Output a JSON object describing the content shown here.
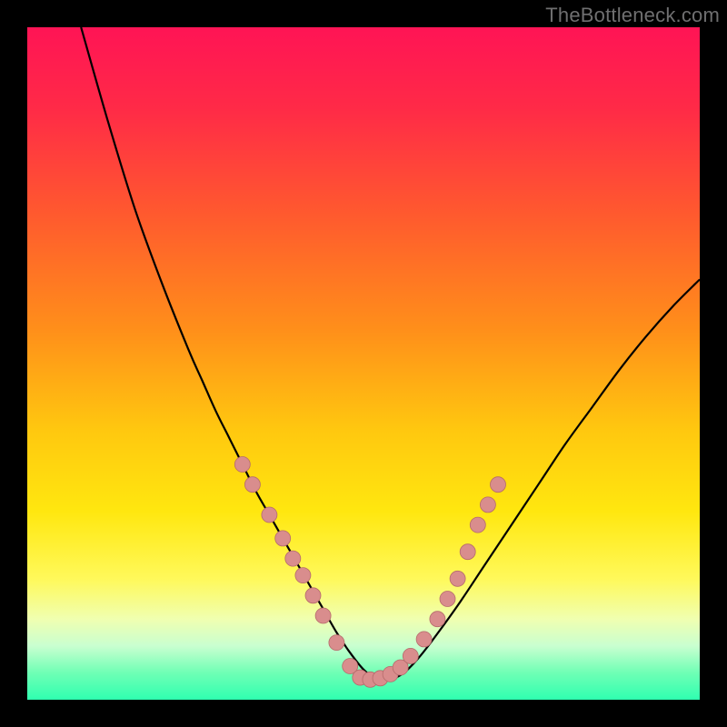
{
  "watermark": "TheBottleneck.com",
  "colors": {
    "background": "#000000",
    "gradient_stops": [
      {
        "offset": 0.0,
        "color": "#ff1455"
      },
      {
        "offset": 0.12,
        "color": "#ff2a47"
      },
      {
        "offset": 0.28,
        "color": "#ff5a2e"
      },
      {
        "offset": 0.45,
        "color": "#ff8f1a"
      },
      {
        "offset": 0.6,
        "color": "#ffc80f"
      },
      {
        "offset": 0.72,
        "color": "#ffe70f"
      },
      {
        "offset": 0.82,
        "color": "#fff95a"
      },
      {
        "offset": 0.88,
        "color": "#f0ffb0"
      },
      {
        "offset": 0.92,
        "color": "#c9ffd0"
      },
      {
        "offset": 0.96,
        "color": "#6fffb5"
      },
      {
        "offset": 1.0,
        "color": "#2fffb0"
      }
    ],
    "curve": "#000000",
    "marker_fill": "#d98d8d",
    "marker_stroke": "#b56b6b"
  },
  "chart_data": {
    "type": "line",
    "title": "",
    "xlabel": "",
    "ylabel": "",
    "xlim": [
      0,
      100
    ],
    "ylim": [
      0,
      100
    ],
    "series": [
      {
        "name": "curve",
        "x": [
          8,
          12,
          16,
          20,
          24,
          26,
          28,
          30,
          32,
          34,
          36,
          38,
          40,
          42,
          44,
          46,
          48,
          50,
          52,
          54,
          56,
          58,
          60,
          64,
          68,
          72,
          76,
          80,
          84,
          88,
          92,
          96,
          100
        ],
        "y": [
          100,
          86,
          73,
          62,
          52,
          47.5,
          43,
          39,
          35,
          31,
          27.5,
          24,
          20.5,
          17,
          13.5,
          10,
          7,
          4.5,
          3,
          3,
          4,
          6,
          8.5,
          14,
          20,
          26,
          32,
          38,
          43.5,
          49,
          54,
          58.5,
          62.5
        ]
      }
    ],
    "markers": {
      "name": "dots",
      "points": [
        {
          "x": 32,
          "y": 35
        },
        {
          "x": 33.5,
          "y": 32
        },
        {
          "x": 36,
          "y": 27.5
        },
        {
          "x": 38,
          "y": 24
        },
        {
          "x": 39.5,
          "y": 21
        },
        {
          "x": 41,
          "y": 18.5
        },
        {
          "x": 42.5,
          "y": 15.5
        },
        {
          "x": 44,
          "y": 12.5
        },
        {
          "x": 46,
          "y": 8.5
        },
        {
          "x": 48,
          "y": 5
        },
        {
          "x": 49.5,
          "y": 3.3
        },
        {
          "x": 51,
          "y": 3
        },
        {
          "x": 52.5,
          "y": 3.2
        },
        {
          "x": 54,
          "y": 3.8
        },
        {
          "x": 55.5,
          "y": 4.8
        },
        {
          "x": 57,
          "y": 6.5
        },
        {
          "x": 59,
          "y": 9
        },
        {
          "x": 61,
          "y": 12
        },
        {
          "x": 62.5,
          "y": 15
        },
        {
          "x": 64,
          "y": 18
        },
        {
          "x": 65.5,
          "y": 22
        },
        {
          "x": 67,
          "y": 26
        },
        {
          "x": 68.5,
          "y": 29
        },
        {
          "x": 70,
          "y": 32
        }
      ]
    }
  }
}
